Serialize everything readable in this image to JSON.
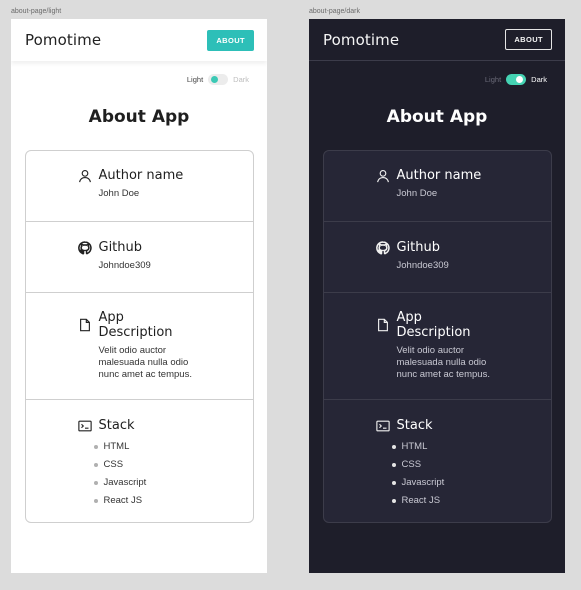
{
  "frames": {
    "light": {
      "label": "about-page/light",
      "brand": "Pomotime",
      "about_button": "ABOUT",
      "toggle": {
        "light_label": "Light",
        "dark_label": "Dark",
        "state": "light"
      },
      "title": "About App",
      "author": {
        "heading": "Author name",
        "value": "John Doe"
      },
      "github": {
        "heading": "Github",
        "value": "Johndoe309"
      },
      "description": {
        "heading": "App Description",
        "value": "Velit odio auctor malesuada nulla odio nunc amet ac tempus."
      },
      "stack": {
        "heading": "Stack",
        "items": [
          "HTML",
          "CSS",
          "Javascript",
          "React JS"
        ]
      }
    },
    "dark": {
      "label": "about-page/dark",
      "brand": "Pomotime",
      "about_button": "ABOUT",
      "toggle": {
        "light_label": "Light",
        "dark_label": "Dark",
        "state": "dark"
      },
      "title": "About App",
      "author": {
        "heading": "Author name",
        "value": "John Doe"
      },
      "github": {
        "heading": "Github",
        "value": "Johndoe309"
      },
      "description": {
        "heading": "App Description",
        "value": "Velit odio auctor malesuada nulla odio nunc amet ac tempus."
      },
      "stack": {
        "heading": "Stack",
        "items": [
          "HTML",
          "CSS",
          "Javascript",
          "React JS"
        ]
      }
    }
  },
  "colors": {
    "accent": "#2dbfb8",
    "toggle_on": "#45d3b3",
    "dark_bg": "#1e1e2a",
    "light_bg": "#ffffff"
  },
  "icons": {
    "author": "user-icon",
    "github": "github-icon",
    "description": "file-icon",
    "stack": "terminal-icon"
  }
}
